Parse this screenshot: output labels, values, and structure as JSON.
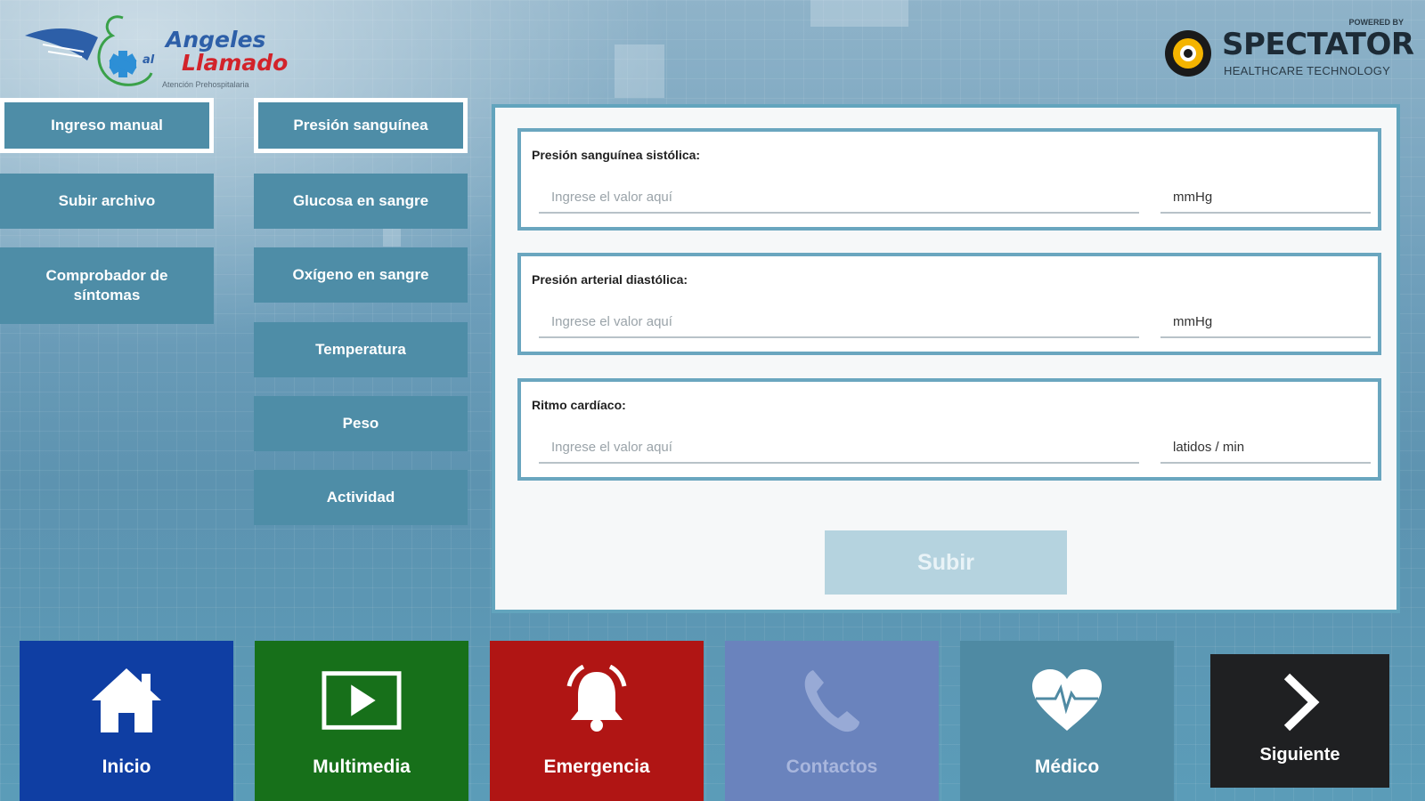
{
  "logo": {
    "title": "Angeles",
    "al": "al",
    "subtitle": "Llamado",
    "tagline": "Atención Prehospitalaria"
  },
  "brand": {
    "powered": "POWERED BY",
    "name": "SPECTATOR",
    "tagline": "HEALTHCARE TECHNOLOGY"
  },
  "left_menu": {
    "items": [
      {
        "label": "Ingreso manual",
        "selected": true
      },
      {
        "label": "Subir archivo",
        "selected": false
      },
      {
        "label": "Comprobador de síntomas",
        "selected": false
      }
    ]
  },
  "measure_menu": {
    "items": [
      {
        "label": "Presión sanguínea",
        "selected": true
      },
      {
        "label": "Glucosa en sangre",
        "selected": false
      },
      {
        "label": "Oxígeno en sangre",
        "selected": false
      },
      {
        "label": "Temperatura",
        "selected": false
      },
      {
        "label": "Peso",
        "selected": false
      },
      {
        "label": "Actividad",
        "selected": false
      }
    ]
  },
  "form": {
    "fields": [
      {
        "label": "Presión sanguínea sistólica:",
        "placeholder": "Ingrese el valor aquí",
        "value": "",
        "unit": "mmHg"
      },
      {
        "label": "Presión arterial diastólica:",
        "placeholder": "Ingrese el valor aquí",
        "value": "",
        "unit": "mmHg"
      },
      {
        "label": "Ritmo cardíaco:",
        "placeholder": "Ingrese el valor aquí",
        "value": "",
        "unit": "latidos / min"
      }
    ],
    "submit_label": "Subir"
  },
  "bottom_nav": {
    "items": [
      {
        "label": "Inicio",
        "icon": "home-icon",
        "color": "#0f3ea3"
      },
      {
        "label": "Multimedia",
        "icon": "play-icon",
        "color": "#17701a"
      },
      {
        "label": "Emergencia",
        "icon": "bell-icon",
        "color": "#b01514"
      },
      {
        "label": "Contactos",
        "icon": "phone-icon",
        "color": "#6a83bd"
      },
      {
        "label": "Médico",
        "icon": "heart-pulse-icon",
        "color": "#4f8aa3"
      }
    ],
    "next_label": "Siguiente",
    "next_icon": "chevron-right-icon"
  },
  "colors": {
    "menu_button": "#4e8da7",
    "card_border": "#62a4bd",
    "submit_disabled": "#b5d3df"
  }
}
